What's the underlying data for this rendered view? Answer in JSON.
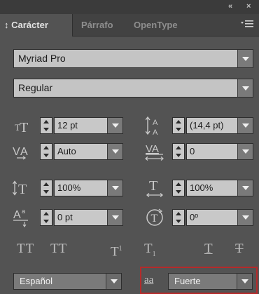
{
  "window": {
    "collapse_label": "«",
    "close_label": "×"
  },
  "tabs": [
    {
      "label": "Carácter",
      "prefix": "↕"
    },
    {
      "label": "Párrafo"
    },
    {
      "label": "OpenType"
    }
  ],
  "font": {
    "family": "Myriad Pro",
    "style": "Regular"
  },
  "fields": {
    "size": "12 pt",
    "leading": "(14,4 pt)",
    "kerning": "Auto",
    "tracking": "0",
    "vertical_scale": "100%",
    "horizontal_scale": "100%",
    "baseline_shift": "0 pt",
    "rotation": "0º"
  },
  "style_buttons": {
    "all_caps": "TT",
    "small_caps": "TT",
    "superscript": "T",
    "subscript": "T",
    "underline": "T",
    "strikethrough": "T"
  },
  "language": "Español",
  "anti_alias": {
    "icon_text": "aa",
    "value": "Fuerte"
  },
  "colors": {
    "panel_bg": "#535353",
    "highlight_border": "#b52a2a"
  }
}
